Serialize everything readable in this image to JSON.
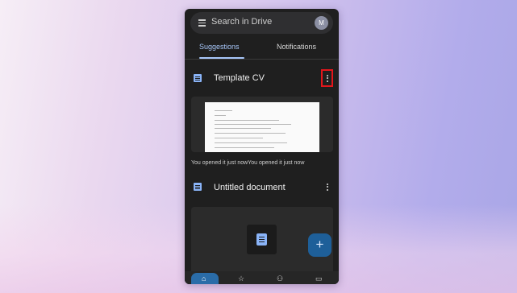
{
  "search": {
    "placeholder": "Search in Drive",
    "avatar_letter": "M"
  },
  "tabs": [
    {
      "label": "Suggestions"
    },
    {
      "label": "Notifications"
    }
  ],
  "files": [
    {
      "title": "Template CV",
      "opened_text": "You opened it just nowYou opened it just now",
      "icon": "docs-icon"
    },
    {
      "title": "Untitled document",
      "icon": "docs-icon"
    }
  ],
  "fab": {
    "label": "+",
    "icon": "plus-icon"
  },
  "nav": [
    {
      "icon": "home-icon",
      "glyph": "⌂"
    },
    {
      "icon": "star-icon",
      "glyph": "☆"
    },
    {
      "icon": "shared-icon",
      "glyph": "⚇"
    },
    {
      "icon": "files-icon",
      "glyph": "▭"
    }
  ],
  "colors": {
    "accent": "#a8c7fa",
    "highlight": "#e4161b",
    "fab": "#1e5f99",
    "nav_active": "#2a6ca8"
  }
}
